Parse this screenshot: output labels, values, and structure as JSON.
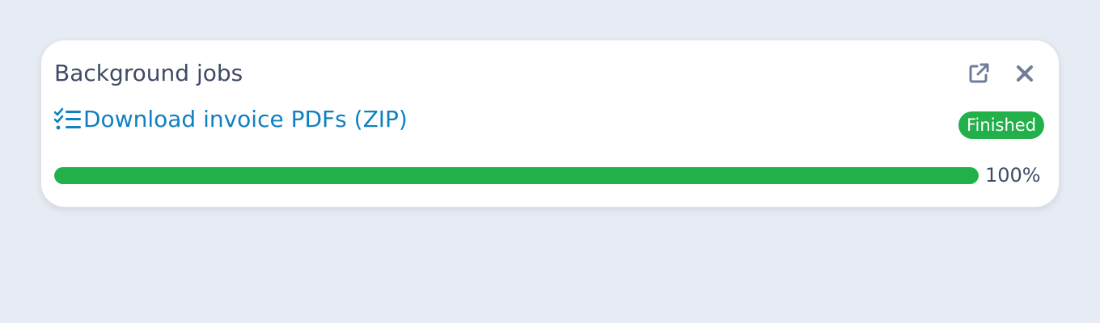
{
  "panel": {
    "title": "Background jobs",
    "actions": {
      "open_icon": "external-link-icon",
      "close_icon": "close-icon"
    }
  },
  "job": {
    "icon": "checklist-icon",
    "label": "Download invoice PDFs (ZIP)",
    "status": "Finished",
    "progress": 1.0,
    "progress_text": "100%"
  },
  "colors": {
    "background": "#e7ebf3",
    "title_text": "#3f4b66",
    "link": "#1180c0",
    "success": "#22b04b",
    "icon_gray": "#6e7d9a"
  }
}
